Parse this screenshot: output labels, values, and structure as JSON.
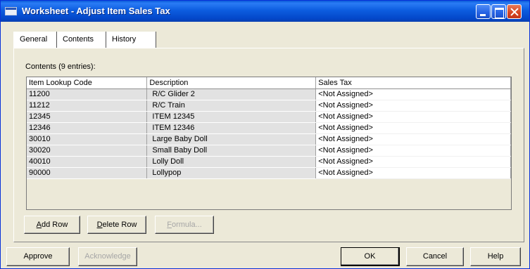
{
  "window": {
    "title": "Worksheet - Adjust Item Sales Tax"
  },
  "tabs": [
    {
      "label": "General"
    },
    {
      "label": "Contents"
    },
    {
      "label": "History"
    }
  ],
  "contents": {
    "label": "Contents (9 entries):",
    "columns": [
      "Item Lookup Code",
      "Description",
      "Sales Tax"
    ],
    "rows": [
      [
        "11200",
        "R/C Glider 2",
        "<Not Assigned>"
      ],
      [
        "11212",
        "R/C Train",
        "<Not Assigned>"
      ],
      [
        "12345",
        "ITEM 12345",
        "<Not Assigned>"
      ],
      [
        "12346",
        "ITEM 12346",
        "<Not Assigned>"
      ],
      [
        "30010",
        "Large Baby Doll",
        "<Not Assigned>"
      ],
      [
        "30020",
        "Small Baby Doll",
        "<Not Assigned>"
      ],
      [
        "40010",
        "Lolly Doll",
        "<Not Assigned>"
      ],
      [
        "90000",
        "Lollypop",
        "<Not Assigned>"
      ]
    ]
  },
  "grid_buttons": {
    "add_row": {
      "first": "A",
      "rest": "dd Row"
    },
    "delete_row": {
      "first": "D",
      "rest": "elete Row"
    },
    "formula": {
      "first": "F",
      "rest": "ormula..."
    }
  },
  "footer": {
    "approve": "Approve",
    "acknowledge": "Acknowledge",
    "ok": "OK",
    "cancel": "Cancel",
    "help": "Help"
  },
  "icons": [
    "window-icon",
    "minimize-icon",
    "maximize-icon",
    "close-icon"
  ],
  "colors": {
    "titlebar": "#0a5ad8",
    "face": "#ece9d8",
    "close": "#d6431f"
  }
}
